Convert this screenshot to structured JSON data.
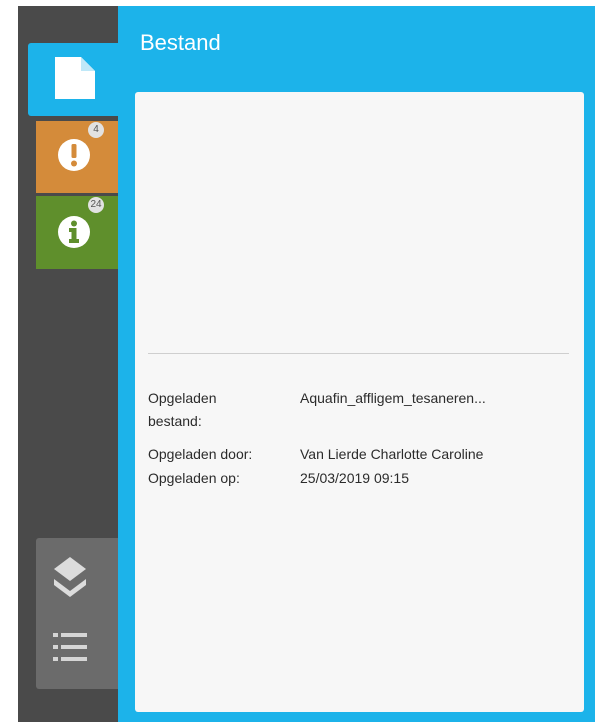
{
  "panel": {
    "title": "Bestand"
  },
  "tabs": [
    {
      "name": "file",
      "icon": "file-icon"
    },
    {
      "name": "warnings",
      "icon": "exclamation-circle-icon",
      "badge": "4"
    },
    {
      "name": "info",
      "icon": "info-circle-icon",
      "badge": "24"
    }
  ],
  "tools": [
    {
      "name": "layers",
      "icon": "layers-icon"
    },
    {
      "name": "legend",
      "icon": "list-icon"
    }
  ],
  "file_info": {
    "uploaded_file_label_line1": "Opgeladen",
    "uploaded_file_label_line2": "bestand:",
    "uploaded_file_value": "Aquafin_affligem_tesaneren...",
    "uploaded_by_label": "Opgeladen door:",
    "uploaded_by_value": "Van Lierde Charlotte Caroline",
    "uploaded_on_label": "Opgeladen op:",
    "uploaded_on_value": "25/03/2019 09:15"
  },
  "colors": {
    "accent": "#1cb3ea",
    "warning": "#d48b3a",
    "info": "#5f8f2c",
    "sidebar": "#4a4a4a",
    "toolbar": "#6b6b6b"
  }
}
